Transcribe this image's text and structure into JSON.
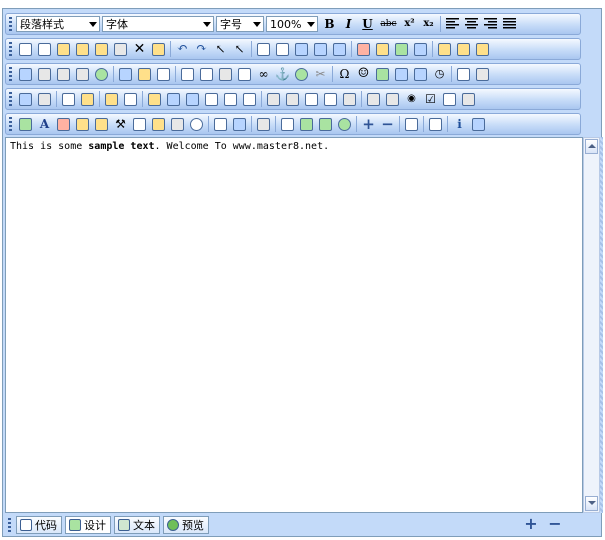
{
  "toolbar1": {
    "paragraph_style": "段落样式",
    "font": "字体",
    "font_size": "字号",
    "zoom": "100%",
    "bold": "B",
    "italic": "I",
    "underline": "U",
    "strikethrough": "abc",
    "superscript": "x²",
    "subscript": "x₂"
  },
  "content": {
    "text_before": "This is some ",
    "text_bold": "sample text",
    "text_after": ". Welcome To www.master8.net."
  },
  "tabs": [
    {
      "label": "代码",
      "icon": "code-icon"
    },
    {
      "label": "设计",
      "icon": "design-icon"
    },
    {
      "label": "文本",
      "icon": "text-icon"
    },
    {
      "label": "预览",
      "icon": "preview-icon"
    }
  ],
  "zoom_controls": {
    "plus": "+",
    "minus": "−"
  }
}
